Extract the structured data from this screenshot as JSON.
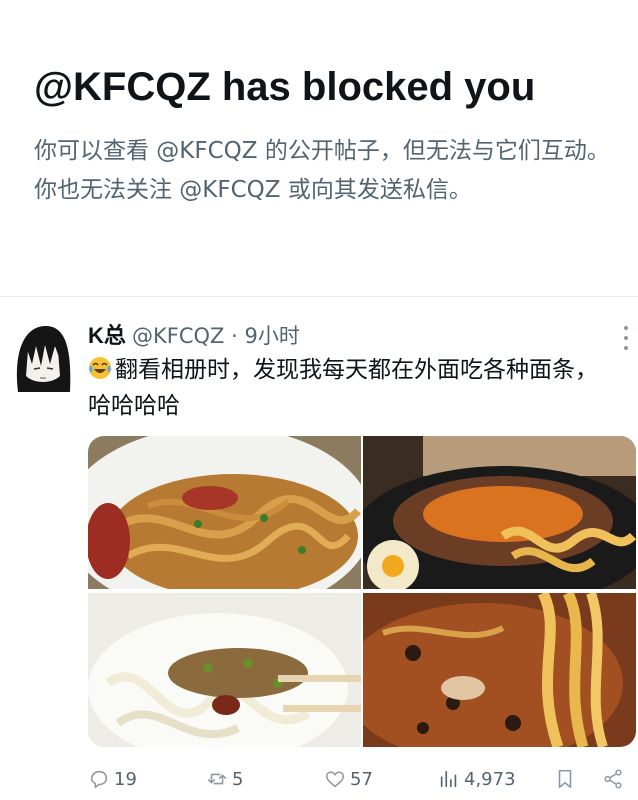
{
  "blocked": {
    "title": "@KFCQZ has blocked you",
    "message": "你可以查看 @KFCQZ 的公开帖子，但无法与它们互动。你也无法关注 @KFCQZ 或向其发送私信。"
  },
  "tweet": {
    "display_name": "K总",
    "handle": "@KFCQZ",
    "separator": " · ",
    "time": "9小时",
    "emoji": "laughing-tears-emoji",
    "text": "翻看相册时，发现我每天都在外面吃各种面条，哈哈哈哈",
    "media": [
      {
        "icon": "noodle-photo"
      },
      {
        "icon": "noodle-photo"
      },
      {
        "icon": "noodle-photo"
      },
      {
        "icon": "noodle-photo"
      }
    ],
    "actions": {
      "replies": "19",
      "retweets": "5",
      "likes": "57",
      "views": "4,973"
    }
  },
  "colors": {
    "text_primary": "#0f1419",
    "text_secondary": "#536471",
    "divider": "#e6ecf0"
  }
}
